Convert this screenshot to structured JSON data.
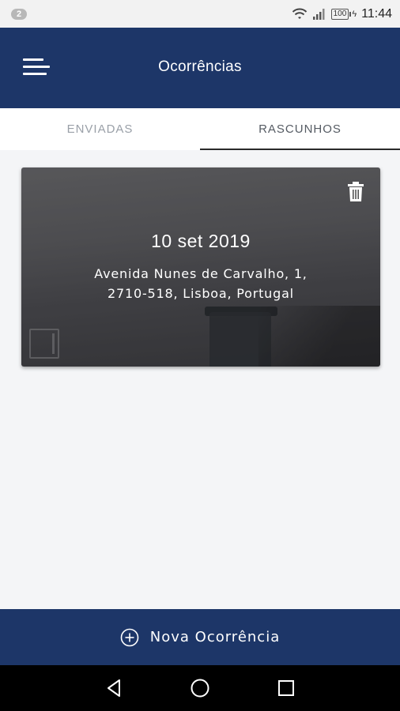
{
  "status_bar": {
    "notification_count": "2",
    "battery": "100",
    "time": "11:44",
    "icons": [
      "wifi-icon",
      "signal-icon",
      "battery-icon",
      "charging-icon"
    ]
  },
  "app_bar": {
    "title": "Ocorrências",
    "menu_icon": "menu-icon",
    "color": "#1d3668"
  },
  "tabs": [
    {
      "label": "ENVIADAS",
      "active": false
    },
    {
      "label": "RASCUNHOS",
      "active": true
    }
  ],
  "drafts": [
    {
      "date": "10 set 2019",
      "address_line1": "Avenida Nunes de Carvalho, 1,",
      "address_line2": "2710-518, Lisboa, Portugal",
      "delete_icon": "trash-icon"
    }
  ],
  "new_button": {
    "label": "Nova Ocorrência",
    "icon": "plus-circle-icon"
  },
  "nav_bar": {
    "icons": [
      "back-icon",
      "home-icon",
      "recents-icon"
    ]
  }
}
